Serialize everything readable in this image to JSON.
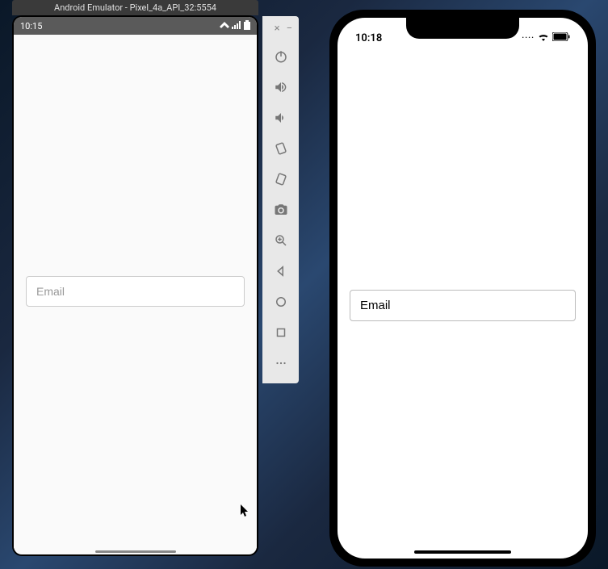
{
  "android": {
    "window_title": "Android Emulator - Pixel_4a_API_32:5554",
    "status_time": "10:15",
    "input_placeholder": "Email"
  },
  "ios": {
    "status_time": "10:18",
    "input_placeholder": "Email"
  },
  "toolbar": {
    "close_label": "×",
    "minimize_label": "−",
    "icons": [
      "power",
      "volume-up",
      "volume-down",
      "rotate-left",
      "rotate-right",
      "camera",
      "zoom",
      "back",
      "home",
      "overview",
      "more"
    ]
  }
}
